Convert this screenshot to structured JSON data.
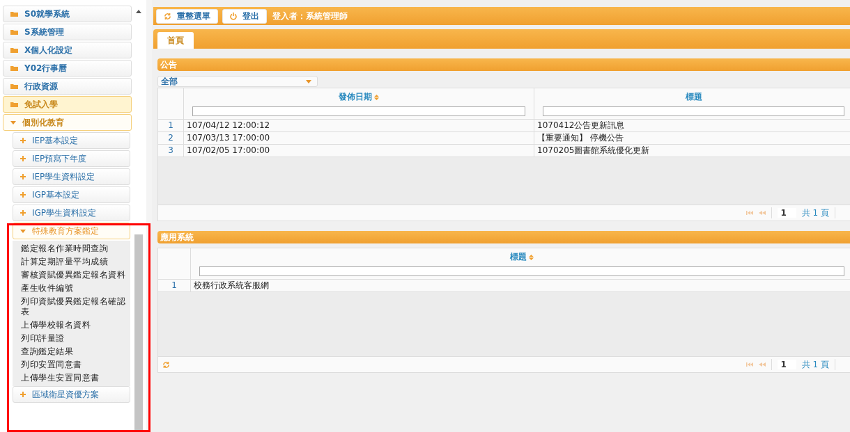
{
  "sidebar": {
    "items": [
      {
        "kind": "folder",
        "label": "S0就學系統",
        "expanded": false,
        "selected": false
      },
      {
        "kind": "folder",
        "label": "S系統管理",
        "expanded": false,
        "selected": false
      },
      {
        "kind": "folder",
        "label": "X個人化設定",
        "expanded": false,
        "selected": false
      },
      {
        "kind": "folder",
        "label": "Y02行事曆",
        "expanded": false,
        "selected": false
      },
      {
        "kind": "folder",
        "label": "行政資源",
        "expanded": false,
        "selected": false
      },
      {
        "kind": "folder",
        "label": "免試入學",
        "expanded": false,
        "selected": true
      },
      {
        "kind": "folder",
        "label": "個別化教育",
        "expanded": true,
        "selected": false,
        "children": [
          {
            "kind": "group",
            "label": "IEP基本設定",
            "expanded": false,
            "selected": false
          },
          {
            "kind": "group",
            "label": "IEP預寫下年度",
            "expanded": false,
            "selected": false
          },
          {
            "kind": "group",
            "label": "IEP學生資料設定",
            "expanded": false,
            "selected": false
          },
          {
            "kind": "group",
            "label": "IGP基本設定",
            "expanded": false,
            "selected": false
          },
          {
            "kind": "group",
            "label": "IGP學生資料設定",
            "expanded": false,
            "selected": false
          },
          {
            "kind": "group",
            "label": "特殊教育方案鑑定",
            "expanded": true,
            "selected": false,
            "children": [
              {
                "kind": "link",
                "label": "鑑定報名作業時間查詢",
                "selected": false
              },
              {
                "kind": "link",
                "label": "計算定期評量平均成績",
                "selected": false
              },
              {
                "kind": "link",
                "label": "審核資賦優異鑑定報名資料",
                "selected": false
              },
              {
                "kind": "link",
                "label": "產生收件編號",
                "selected": false
              },
              {
                "kind": "link",
                "label": "列印資賦優異鑑定報名確認表",
                "selected": false
              },
              {
                "kind": "link",
                "label": "上傳學校報名資料",
                "selected": false
              },
              {
                "kind": "link",
                "label": "列印評量證",
                "selected": false
              },
              {
                "kind": "link",
                "label": "查詢鑑定結果",
                "selected": false
              },
              {
                "kind": "link",
                "label": "列印安置同意書",
                "selected": false
              },
              {
                "kind": "link",
                "label": "上傳學生安置同意書",
                "selected": false
              }
            ]
          },
          {
            "kind": "group",
            "label": "區域衛星資優方案",
            "expanded": false,
            "selected": false
          }
        ]
      }
    ]
  },
  "toolbar": {
    "buttons": [
      {
        "label": "重整選單"
      },
      {
        "label": "登出"
      }
    ],
    "user": "登入者：系統管理師"
  },
  "tabs": [
    {
      "label": "首頁",
      "selected": true
    }
  ],
  "panels": [
    {
      "title": "公告",
      "filter": {
        "value": "全部"
      },
      "columns": [
        {
          "label": "發佈日期",
          "sortable": true
        },
        {
          "label": "標題",
          "sortable": false
        }
      ],
      "rows": [
        {
          "number": "1",
          "cells": [
            "107/04/12 12:00:12",
            "1070412公告更新訊息"
          ]
        },
        {
          "number": "2",
          "cells": [
            "107/03/13 17:00:00",
            "【重要通知】 停機公告"
          ]
        },
        {
          "number": "3",
          "cells": [
            "107/02/05 17:00:00",
            "1070205圖書館系統優化更新"
          ]
        }
      ],
      "pager": {
        "page": "1",
        "total": "共 1 頁"
      }
    },
    {
      "title": "應用系統",
      "columns": [
        {
          "label": "標題",
          "sortable": true
        }
      ],
      "rows": [
        {
          "number": "1",
          "cells": [
            "校務行政系統客服網"
          ]
        }
      ],
      "footer_refresh": true,
      "pager": {
        "page": "1",
        "total": "共 1 頁"
      }
    }
  ]
}
